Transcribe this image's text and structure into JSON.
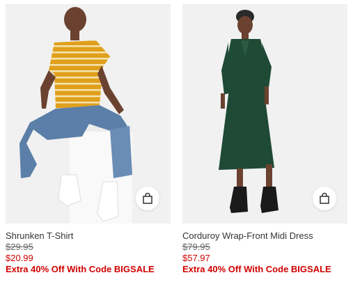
{
  "products": [
    {
      "name": "Shrunken T-Shirt",
      "original_price": "$29.95",
      "sale_price": "$20.99",
      "promo": "Extra 40% Off With Code BIGSALE",
      "image_icon": "model-striped-tshirt-image",
      "bag_icon": "shopping-bag-icon"
    },
    {
      "name": "Corduroy Wrap-Front Midi Dress",
      "original_price": "$79.95",
      "sale_price": "$57.97",
      "promo": "Extra 40% Off With Code BIGSALE",
      "image_icon": "model-green-dress-image",
      "bag_icon": "shopping-bag-icon"
    }
  ],
  "colors": {
    "sale_red": "#d00000",
    "text_dark": "#333333",
    "strike_gray": "#666666",
    "image_bg": "#f1f1f1",
    "shirt_mustard": "#e0a01c",
    "jeans_blue": "#5b7fa8",
    "dress_green": "#1f4a35"
  }
}
